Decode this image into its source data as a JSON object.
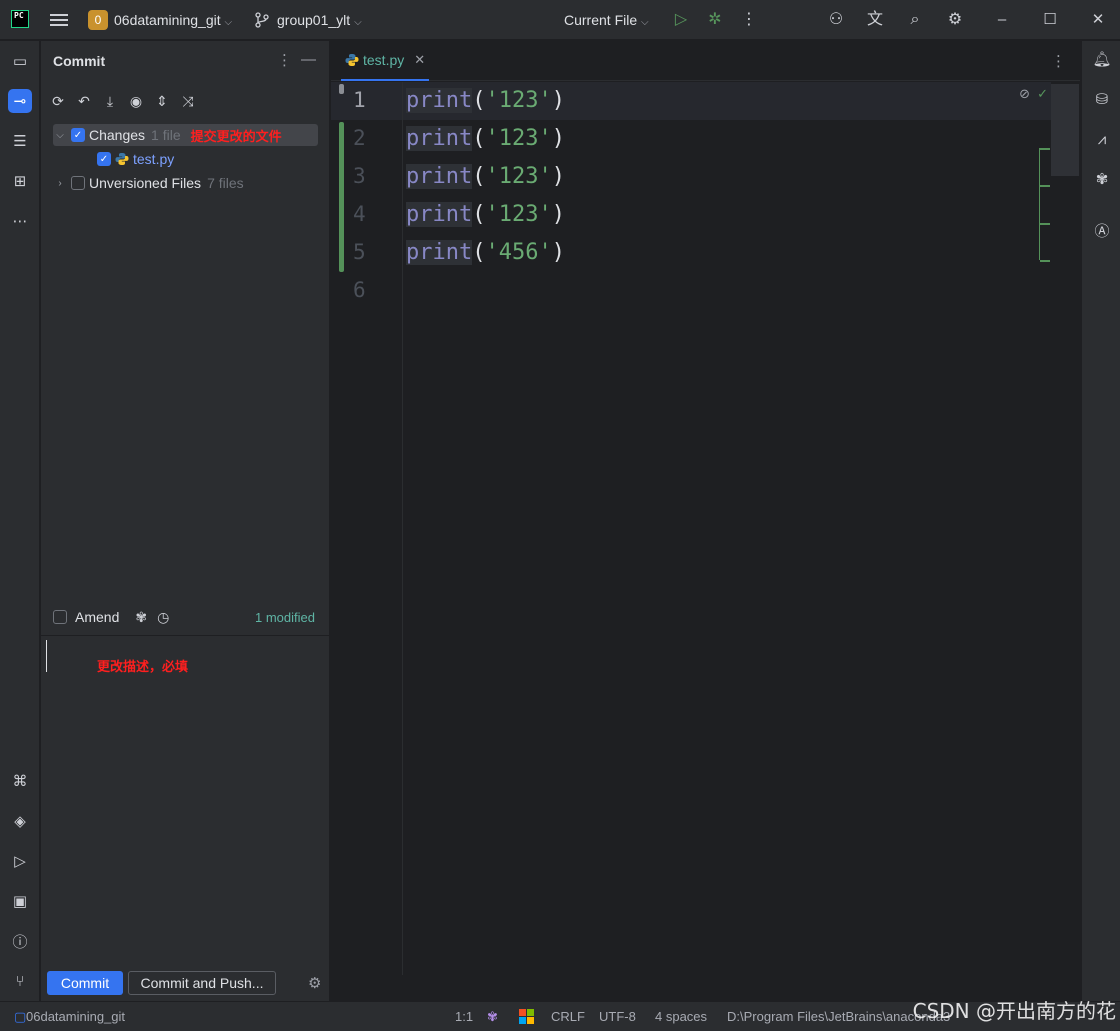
{
  "titlebar": {
    "app_logo": "PC",
    "project_badge": "0",
    "project_name": "06datamining_git",
    "branch": "group01_ylt",
    "run_config": "Current File"
  },
  "commit_panel": {
    "title": "Commit",
    "changes_label": "Changes",
    "changes_count": "1 file",
    "changes_annotation": "提交更改的文件",
    "file_name": "test.py",
    "unversioned_label": "Unversioned Files",
    "unversioned_count": "7 files",
    "amend_label": "Amend",
    "modified_label": "1 modified",
    "message_annotation": "更改描述，必填",
    "commit_button": "Commit",
    "commit_push_button": "Commit and Push..."
  },
  "editor": {
    "tab_name": "test.py",
    "lines": [
      {
        "n": "1",
        "fn": "print",
        "open": "(",
        "arg": "'123'",
        "close": ")"
      },
      {
        "n": "2",
        "fn": "print",
        "open": "(",
        "arg": "'123'",
        "close": ")"
      },
      {
        "n": "3",
        "fn": "print",
        "open": "(",
        "arg": "'123'",
        "close": ")"
      },
      {
        "n": "4",
        "fn": "print",
        "open": "(",
        "arg": "'123'",
        "close": ")"
      },
      {
        "n": "5",
        "fn": "print",
        "open": "(",
        "arg": "'456'",
        "close": ")"
      },
      {
        "n": "6",
        "fn": "",
        "open": "",
        "arg": "",
        "close": ""
      }
    ]
  },
  "statusbar": {
    "project": "06datamining_git",
    "position": "1:1",
    "line_ending": "CRLF",
    "encoding": "UTF-8",
    "indent": "4 spaces",
    "interpreter_path": "D:\\Program Files\\JetBrains\\anaconda3"
  },
  "watermark": "CSDN @开出南方的花",
  "colors": {
    "accent": "#3574f0",
    "vcs_change": "#549159",
    "string": "#6aab73",
    "builtin": "#8888c6",
    "annotation": "#ff1f1f"
  }
}
